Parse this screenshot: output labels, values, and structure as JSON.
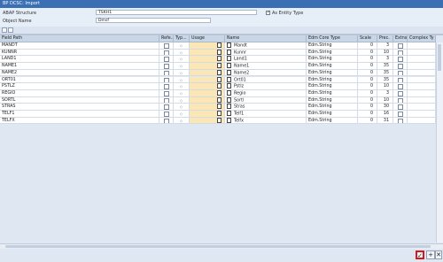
{
  "window": {
    "title": "BP DCSC: Import"
  },
  "form": {
    "abap_structure_label": "ABAP Structure",
    "abap_structure_value": "TSKH1",
    "as_entity_type_label": "As Entity Type",
    "as_entity_type_checked": true,
    "object_name_label": "Object Name",
    "object_name_value": "Dmsf"
  },
  "grid": {
    "headers": {
      "field_path": "Field Path",
      "reference": "Refe...",
      "type": "Typ...",
      "usage": "Usage",
      "name": "Name",
      "edm_core_type": "Edm Core Type",
      "scale": "Scale",
      "precision": "Prec.",
      "extension": "Extns",
      "complex_type": "Complex Ty"
    },
    "rows": [
      {
        "field_path": "MANDT",
        "name": "Mandt",
        "edm": "Edm.String",
        "scale": "0",
        "prec": "3"
      },
      {
        "field_path": "KUNNR",
        "name": "Kunnr",
        "edm": "Edm.String",
        "scale": "0",
        "prec": "10"
      },
      {
        "field_path": "LAND1",
        "name": "Land1",
        "edm": "Edm.String",
        "scale": "0",
        "prec": "3"
      },
      {
        "field_path": "NAME1",
        "name": "Name1",
        "edm": "Edm.String",
        "scale": "0",
        "prec": "35"
      },
      {
        "field_path": "NAME2",
        "name": "Name2",
        "edm": "Edm.String",
        "scale": "0",
        "prec": "35"
      },
      {
        "field_path": "ORT01",
        "name": "Ort01",
        "edm": "Edm.String",
        "scale": "0",
        "prec": "35"
      },
      {
        "field_path": "PSTLZ",
        "name": "Pstlz",
        "edm": "Edm.String",
        "scale": "0",
        "prec": "10"
      },
      {
        "field_path": "REGIO",
        "name": "Regio",
        "edm": "Edm.String",
        "scale": "0",
        "prec": "3"
      },
      {
        "field_path": "SORTL",
        "name": "Sortl",
        "edm": "Edm.String",
        "scale": "0",
        "prec": "10"
      },
      {
        "field_path": "STRAS",
        "name": "Stras",
        "edm": "Edm.String",
        "scale": "0",
        "prec": "30"
      },
      {
        "field_path": "TELF1",
        "name": "Telf1",
        "edm": "Edm.String",
        "scale": "0",
        "prec": "16"
      },
      {
        "field_path": "TELFX",
        "name": "Telfx",
        "edm": "Edm.String",
        "scale": "0",
        "prec": "31"
      }
    ]
  },
  "colors": {
    "title_bar": "#3a6fb3",
    "usage_highlight": "#fbe7b5",
    "ok_border": "#d01c1c"
  },
  "footer": {
    "ok_icon": "checkmark-icon",
    "add_icon": "add-icon",
    "cancel_icon": "cancel-icon"
  }
}
